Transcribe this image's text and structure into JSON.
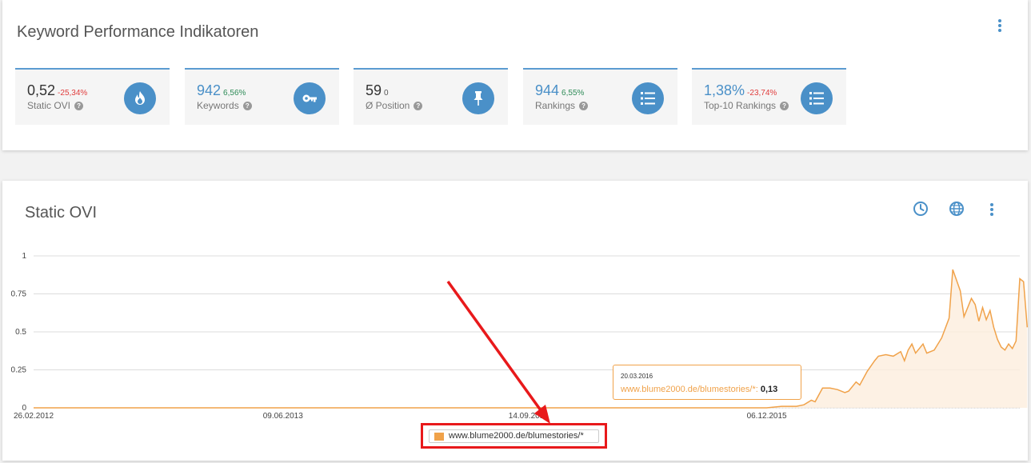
{
  "kpi_panel": {
    "title": "Keyword Performance Indikatoren",
    "cards": [
      {
        "value": "0,52",
        "delta": "-25,34%",
        "delta_type": "negative",
        "label": "Static OVI",
        "icon": "flame-icon"
      },
      {
        "value": "942",
        "delta": "6,56%",
        "delta_type": "positive",
        "label": "Keywords",
        "icon": "key-icon"
      },
      {
        "value": "59",
        "delta": "0",
        "delta_type": "neutral",
        "label": "Ø Position",
        "icon": "pushpin-icon"
      },
      {
        "value": "944",
        "delta": "6,55%",
        "delta_type": "positive",
        "label": "Rankings",
        "icon": "list-icon"
      },
      {
        "value": "1,38%",
        "delta": "-23,74%",
        "delta_type": "negative",
        "label": "Top-10 Rankings",
        "icon": "list-icon"
      }
    ],
    "help_glyph": "?"
  },
  "chart_panel": {
    "title": "Static OVI",
    "toolbar_icons": [
      "clock-icon",
      "globe-icon",
      "more-vertical-icon"
    ]
  },
  "colors": {
    "accent": "#4a90c8",
    "series": "#f0a24a",
    "negative": "#e03c3c",
    "positive": "#2e8b57",
    "highlight": "#e8191b"
  },
  "chart_data": {
    "type": "area",
    "ylim": [
      0,
      1
    ],
    "y_ticks": [
      "0",
      "0.25",
      "0.5",
      "0.75",
      "1"
    ],
    "y_tick_values": [
      0,
      0.25,
      0.5,
      0.75,
      1
    ],
    "x_ticks": [
      "26.02.2012",
      "09.06.2013",
      "14.09.2014",
      "06.12.2015"
    ],
    "x_start": "2012-02-26",
    "x_end": "2017-03-26",
    "series": [
      {
        "name": "www.blume2000.de/blumestories/*",
        "color": "#f0a24a",
        "points": [
          [
            "2012-02-26",
            0
          ],
          [
            "2015-12-06",
            0
          ],
          [
            "2016-01-03",
            0.01
          ],
          [
            "2016-01-31",
            0.01
          ],
          [
            "2016-02-14",
            0.02
          ],
          [
            "2016-02-28",
            0.05
          ],
          [
            "2016-03-06",
            0.04
          ],
          [
            "2016-03-20",
            0.13
          ],
          [
            "2016-04-03",
            0.13
          ],
          [
            "2016-04-17",
            0.12
          ],
          [
            "2016-05-01",
            0.1
          ],
          [
            "2016-05-08",
            0.11
          ],
          [
            "2016-05-22",
            0.17
          ],
          [
            "2016-05-29",
            0.15
          ],
          [
            "2016-06-12",
            0.24
          ],
          [
            "2016-06-26",
            0.31
          ],
          [
            "2016-07-03",
            0.34
          ],
          [
            "2016-07-17",
            0.35
          ],
          [
            "2016-07-31",
            0.34
          ],
          [
            "2016-08-14",
            0.37
          ],
          [
            "2016-08-21",
            0.31
          ],
          [
            "2016-08-28",
            0.38
          ],
          [
            "2016-09-04",
            0.42
          ],
          [
            "2016-09-11",
            0.36
          ],
          [
            "2016-09-25",
            0.42
          ],
          [
            "2016-10-02",
            0.36
          ],
          [
            "2016-10-16",
            0.38
          ],
          [
            "2016-10-30",
            0.46
          ],
          [
            "2016-11-13",
            0.59
          ],
          [
            "2016-11-20",
            0.91
          ],
          [
            "2016-12-04",
            0.77
          ],
          [
            "2016-12-11",
            0.6
          ],
          [
            "2016-12-25",
            0.72
          ],
          [
            "2017-01-01",
            0.68
          ],
          [
            "2017-01-08",
            0.57
          ],
          [
            "2017-01-15",
            0.66
          ],
          [
            "2017-01-22",
            0.58
          ],
          [
            "2017-01-29",
            0.64
          ],
          [
            "2017-02-05",
            0.53
          ],
          [
            "2017-02-12",
            0.45
          ],
          [
            "2017-02-19",
            0.4
          ],
          [
            "2017-02-26",
            0.38
          ],
          [
            "2017-03-05",
            0.42
          ],
          [
            "2017-03-12",
            0.39
          ],
          [
            "2017-03-19",
            0.44
          ],
          [
            "2017-03-26",
            0.85
          ],
          [
            "2017-04-02",
            0.83
          ],
          [
            "2017-04-09",
            0.53
          ]
        ]
      }
    ],
    "legend": "bottom-center",
    "grid": true,
    "tooltip": {
      "date": "20.03.2016",
      "series": "www.blume2000.de/blumestories/*:",
      "value": "0,13"
    }
  }
}
